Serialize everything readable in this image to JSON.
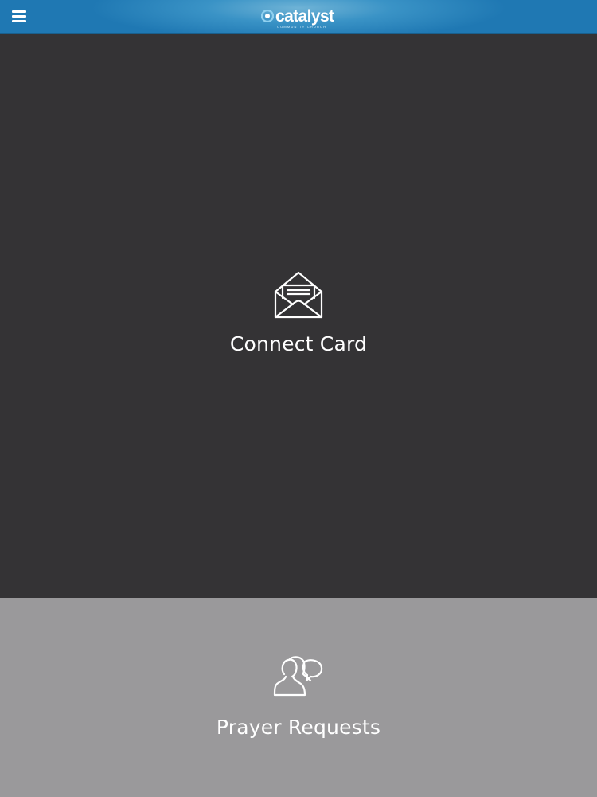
{
  "header": {
    "menu_icon": "hamburger-menu-icon",
    "logo": {
      "text": "catalyst",
      "subtext": "COMMUNITY CHURCH",
      "mark_icon": "catalyst-logo-mark"
    },
    "colors": {
      "background": "#2a86bd",
      "highlight": "#6fb3d6"
    }
  },
  "tiles": [
    {
      "label": "Connect Card",
      "icon": "open-envelope-icon",
      "background": "#343335"
    },
    {
      "label": "Prayer Requests",
      "icon": "people-speech-bubble-icon",
      "background": "#9a999b"
    }
  ]
}
